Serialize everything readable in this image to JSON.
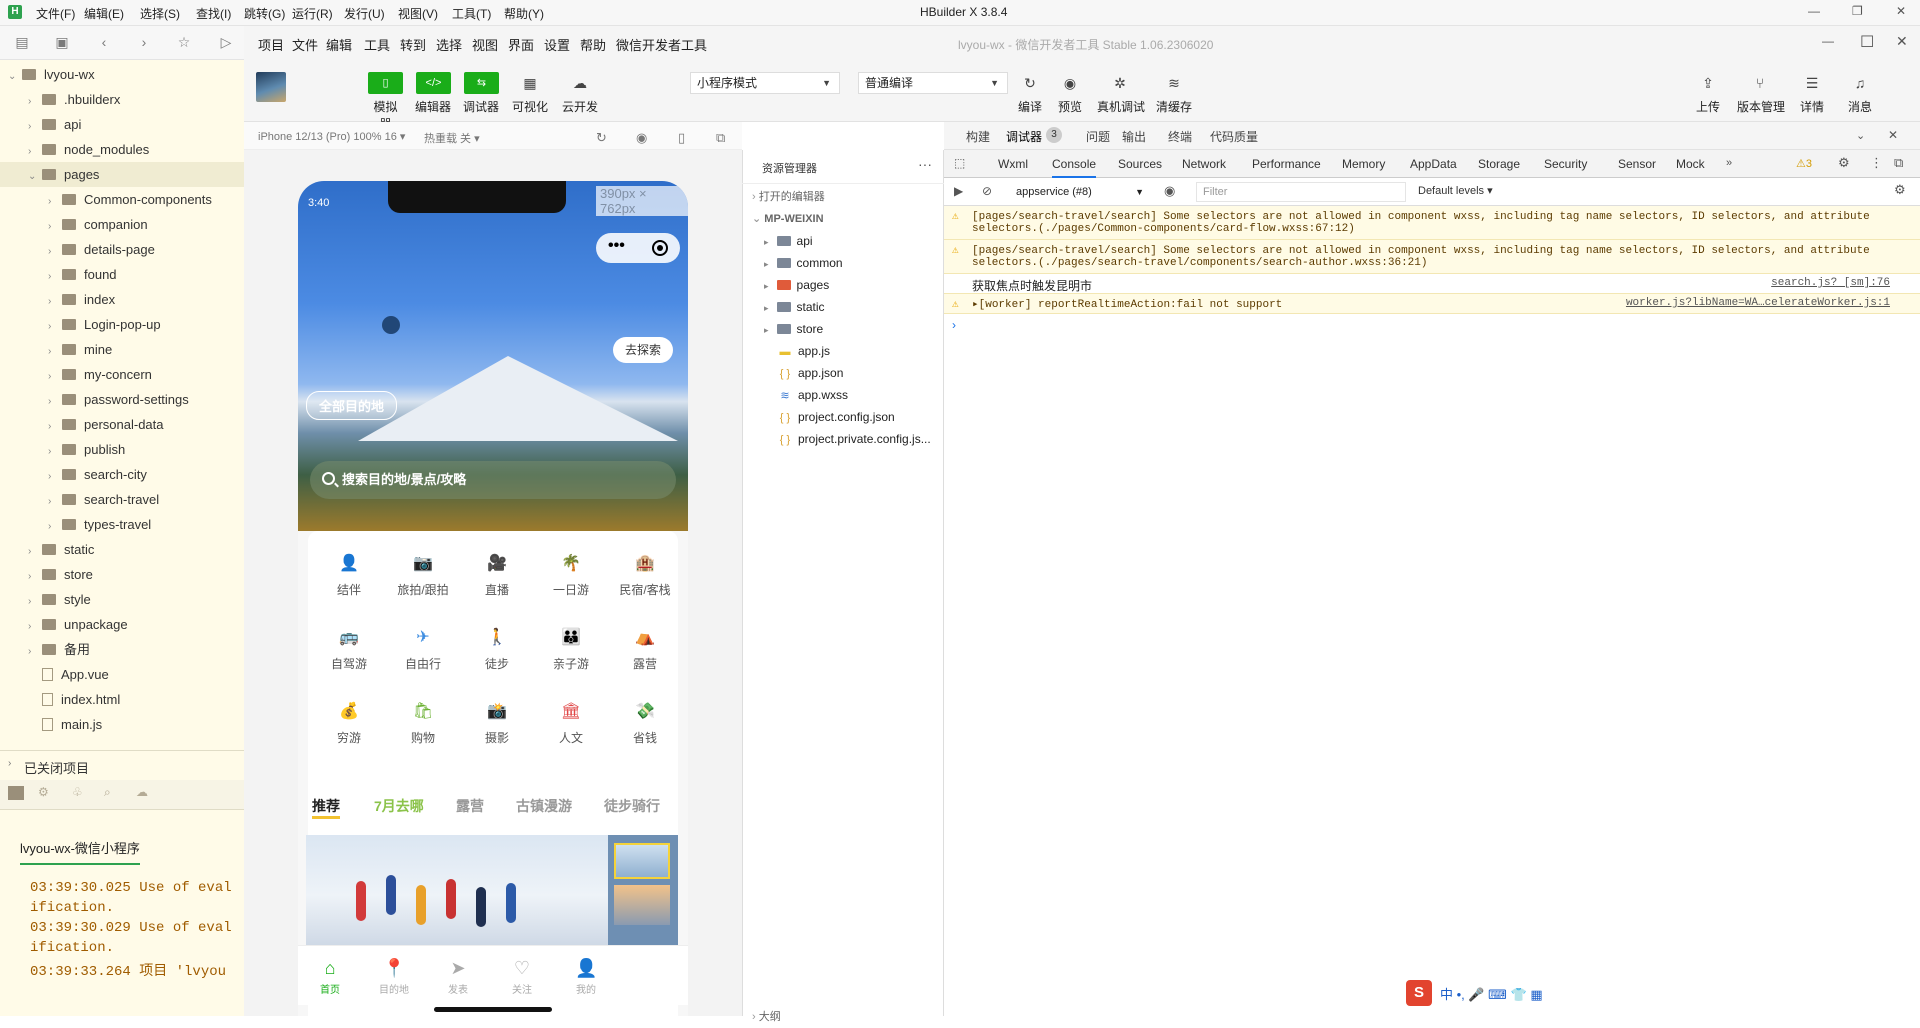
{
  "hbuilder": {
    "title": "HBuilder X 3.8.4",
    "logo": "H",
    "menu": [
      "文件(F)",
      "编辑(E)",
      "选择(S)",
      "查找(I)",
      "跳转(G)",
      "运行(R)",
      "发行(U)",
      "视图(V)",
      "工具(T)",
      "帮助(Y)"
    ],
    "toolbar_icons": [
      "new-file-icon",
      "save-icon",
      "back-icon",
      "forward-icon",
      "star-icon",
      "run-icon"
    ],
    "tree": [
      {
        "label": "lvyou-wx",
        "level": 0,
        "type": "project",
        "expanded": true
      },
      {
        "label": ".hbuilderx",
        "level": 1,
        "type": "folder"
      },
      {
        "label": "api",
        "level": 1,
        "type": "folder"
      },
      {
        "label": "node_modules",
        "level": 1,
        "type": "folder"
      },
      {
        "label": "pages",
        "level": 1,
        "type": "folder",
        "expanded": true,
        "selected": true
      },
      {
        "label": "Common-components",
        "level": 2,
        "type": "folder"
      },
      {
        "label": "companion",
        "level": 2,
        "type": "folder"
      },
      {
        "label": "details-page",
        "level": 2,
        "type": "folder"
      },
      {
        "label": "found",
        "level": 2,
        "type": "folder"
      },
      {
        "label": "index",
        "level": 2,
        "type": "folder"
      },
      {
        "label": "Login-pop-up",
        "level": 2,
        "type": "folder"
      },
      {
        "label": "mine",
        "level": 2,
        "type": "folder"
      },
      {
        "label": "my-concern",
        "level": 2,
        "type": "folder"
      },
      {
        "label": "password-settings",
        "level": 2,
        "type": "folder"
      },
      {
        "label": "personal-data",
        "level": 2,
        "type": "folder"
      },
      {
        "label": "publish",
        "level": 2,
        "type": "folder"
      },
      {
        "label": "search-city",
        "level": 2,
        "type": "folder"
      },
      {
        "label": "search-travel",
        "level": 2,
        "type": "folder"
      },
      {
        "label": "types-travel",
        "level": 2,
        "type": "folder"
      },
      {
        "label": "static",
        "level": 1,
        "type": "folder"
      },
      {
        "label": "store",
        "level": 1,
        "type": "folder"
      },
      {
        "label": "style",
        "level": 1,
        "type": "folder"
      },
      {
        "label": "unpackage",
        "level": 1,
        "type": "folder"
      },
      {
        "label": "备用",
        "level": 1,
        "type": "folder"
      },
      {
        "label": "App.vue",
        "level": 1,
        "type": "file"
      },
      {
        "label": "index.html",
        "level": 1,
        "type": "file"
      },
      {
        "label": "main.js",
        "level": 1,
        "type": "file"
      }
    ],
    "closed_projects": "已关闭项目",
    "console_tab": "lvyou-wx-微信小程序",
    "console_lines": [
      "03:39:30.025 Use of eval",
      "ification.",
      "03:39:30.029 Use of eval",
      "ification.",
      "03:39:33.264 项目 'lvyou"
    ]
  },
  "devtools": {
    "menu": [
      "项目",
      "文件",
      "编辑",
      "工具",
      "转到",
      "选择",
      "视图",
      "界面",
      "设置",
      "帮助",
      "微信开发者工具"
    ],
    "window_title": "lvyou-wx - 微信开发者工具 Stable 1.06.2306020",
    "toolbar": {
      "simulator": "模拟器",
      "editor": "编辑器",
      "debugger": "调试器",
      "visual": "可视化",
      "cloud": "云开发",
      "mode": "小程序模式",
      "compile_mode": "普通编译",
      "compile": "编译",
      "preview": "预览",
      "real_debug": "真机调试",
      "clear_cache": "清缓存",
      "upload": "上传",
      "version": "版本管理",
      "details": "详情",
      "messages": "消息"
    },
    "sim_device": "iPhone 12/13 (Pro) 100% 16 ▾",
    "sim_hot": "热重载 关 ▾",
    "phone": {
      "time": "3:40",
      "size": "390px × 762px",
      "explore": "去探索",
      "all_dest": "全部目的地",
      "search_placeholder": "搜索目的地/景点/攻略",
      "row1": [
        {
          "label": "结伴",
          "icon": "👤",
          "color": "#8e6cd8"
        },
        {
          "label": "旅拍/跟拍",
          "icon": "📷",
          "color": "#f39c2b"
        },
        {
          "label": "直播",
          "icon": "🎥",
          "color": "#3e7de0"
        },
        {
          "label": "一日游",
          "icon": "🌴",
          "color": "#f0a030"
        },
        {
          "label": "民宿/客栈",
          "icon": "🏨",
          "color": "#e04848"
        }
      ],
      "row2": [
        {
          "label": "自驾游",
          "icon": "🚌",
          "color": "#3aa24a"
        },
        {
          "label": "自由行",
          "icon": "✈",
          "color": "#3e8de0"
        },
        {
          "label": "徒步",
          "icon": "🚶",
          "color": "#f07a30"
        },
        {
          "label": "亲子游",
          "icon": "👪",
          "color": "#f0b830"
        },
        {
          "label": "露营",
          "icon": "⛺",
          "color": "#b07ae0"
        }
      ],
      "row3": [
        {
          "label": "穷游",
          "icon": "💰",
          "color": "#3aa24a"
        },
        {
          "label": "购物",
          "icon": "🛍",
          "color": "#6ab030"
        },
        {
          "label": "摄影",
          "icon": "📸",
          "color": "#e0a020"
        },
        {
          "label": "人文",
          "icon": "🏛",
          "color": "#e04848"
        },
        {
          "label": "省钱",
          "icon": "💸",
          "color": "#e04030"
        }
      ],
      "tabs": [
        "推荐",
        "7月去哪",
        "露营",
        "古镇漫游",
        "徒步骑行"
      ],
      "tabbar": [
        {
          "label": "首页",
          "icon": "⌂"
        },
        {
          "label": "目的地",
          "icon": "📍"
        },
        {
          "label": "发表",
          "icon": "➤"
        },
        {
          "label": "关注",
          "icon": "♡"
        },
        {
          "label": "我的",
          "icon": "👤"
        }
      ]
    },
    "explorer": {
      "title": "资源管理器",
      "open_editors": "打开的编辑器",
      "root": "MP-WEIXIN",
      "items": [
        {
          "label": "api",
          "type": "folder"
        },
        {
          "label": "common",
          "type": "folder"
        },
        {
          "label": "pages",
          "type": "folder-red"
        },
        {
          "label": "static",
          "type": "folder"
        },
        {
          "label": "store",
          "type": "folder"
        },
        {
          "label": "app.js",
          "type": "js"
        },
        {
          "label": "app.json",
          "type": "json"
        },
        {
          "label": "app.wxss",
          "type": "css"
        },
        {
          "label": "project.config.json",
          "type": "json"
        },
        {
          "label": "project.private.config.js...",
          "type": "json"
        }
      ],
      "footer": "大纲"
    },
    "tabs1": [
      "构建",
      "调试器",
      "问题",
      "输出",
      "终端",
      "代码质量"
    ],
    "debugger_count": "3",
    "tabs2": [
      "Wxml",
      "Console",
      "Sources",
      "Network",
      "Performance",
      "Memory",
      "AppData",
      "Storage",
      "Security",
      "Sensor",
      "Mock"
    ],
    "warn_count": "3",
    "context": "appservice (#8)",
    "filter": "Filter",
    "levels": "Default levels",
    "console": [
      {
        "type": "warn",
        "text": "[pages/search-travel/search] Some selectors are not allowed in component wxss, including tag name selectors, ID selectors, and attribute",
        "text2": "selectors.(./pages/Common-components/card-flow.wxss:67:12)"
      },
      {
        "type": "warn",
        "text": "[pages/search-travel/search] Some selectors are not allowed in component wxss, including tag name selectors, ID selectors, and attribute",
        "text2": "selectors.(./pages/search-travel/components/search-author.wxss:36:21)"
      },
      {
        "type": "log",
        "text": "获取焦点时触发昆明市",
        "link": "search.js? [sm]:76"
      },
      {
        "type": "warn",
        "text": "▸[worker] reportRealtimeAction:fail not support",
        "link": "worker.js?libName=WA…celerateWorker.js:1"
      }
    ]
  },
  "ime": "中 •, 🎤 ⌨ 👕 ▦"
}
